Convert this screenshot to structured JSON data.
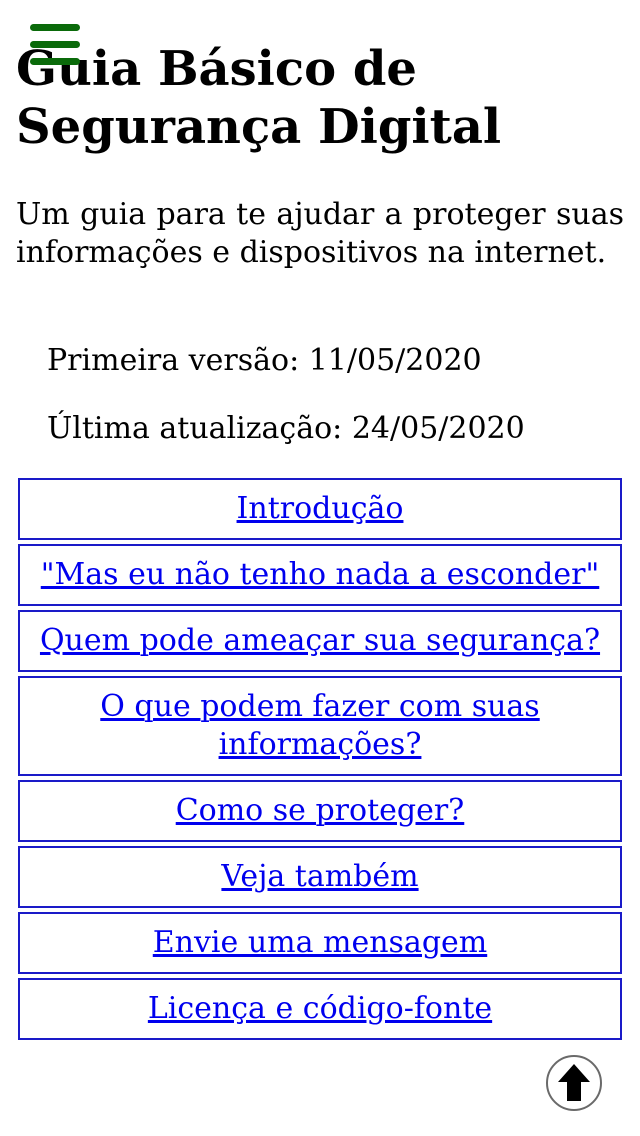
{
  "header": {
    "menu_icon": "hamburger-menu-icon",
    "title": "Guia Básico de Segurança Digital"
  },
  "intro": {
    "text": "Um guia para te ajudar a proteger suas informações e dispositivos na internet."
  },
  "meta": {
    "first_version": "Primeira versão: 11/05/2020",
    "last_update": "Última atualização: 24/05/2020"
  },
  "nav": {
    "items": [
      {
        "label": "Introdução"
      },
      {
        "label": "\"Mas eu não tenho nada a esconder\""
      },
      {
        "label": "Quem pode ameaçar sua segurança?"
      },
      {
        "label": "O que podem fazer com suas informações?"
      },
      {
        "label": "Como se proteger?"
      },
      {
        "label": "Veja também"
      },
      {
        "label": "Envie uma mensagem"
      },
      {
        "label": "Licença e código-fonte"
      }
    ]
  },
  "back_to_top": {
    "icon": "arrow-up-icon"
  },
  "colors": {
    "menu_icon": "#0a6a0a",
    "link": "#0000ee",
    "nav_border": "#1a1ac8"
  }
}
